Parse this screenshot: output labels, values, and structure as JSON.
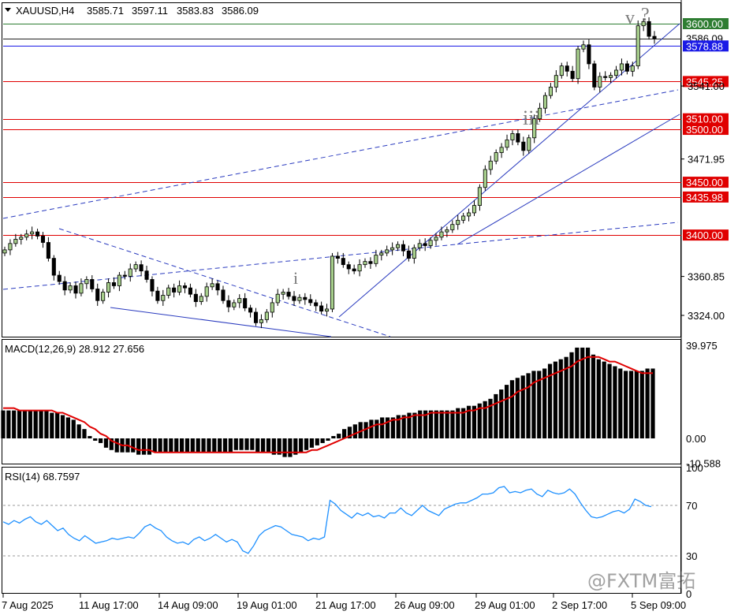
{
  "header": {
    "symbol": "XAUUSD,H4",
    "open": "3585.71",
    "high": "3597.11",
    "low": "3583.83",
    "close": "3586.09"
  },
  "watermark": "@FXTM富拓",
  "wave_labels": {
    "i": "i",
    "iii": "iii",
    "v": "v",
    "q": "?"
  },
  "colors": {
    "candle_up": "#a8d08d",
    "candle_outline": "#000000",
    "level_line": "#e00000",
    "trend_line": "#2a3bbf",
    "bid_line": "#1a1ae6",
    "ask_line": "#2e7d32",
    "macd_signal": "#e00000",
    "rsi_line": "#1e90ff"
  },
  "chart_data": [
    {
      "type": "candlestick",
      "title": "XAUUSD,H4",
      "ylim": [
        3310,
        3630
      ],
      "y_ticks": [
        "3360.85",
        "3324.00",
        "3471.95",
        "3541.00"
      ],
      "x_ticks": [
        "7 Aug 2025",
        "11 Aug 17:00",
        "14 Aug 09:00",
        "19 Aug 01:00",
        "21 Aug 17:00",
        "26 Aug 09:00",
        "29 Aug 01:00",
        "2 Sep 17:00",
        "5 Sep 09:00"
      ],
      "price_labels": [
        {
          "label": "3600.00",
          "value": 3600,
          "kind": "ask"
        },
        {
          "label": "3586.09",
          "value": 3586.09,
          "kind": "current"
        },
        {
          "label": "3578.88",
          "value": 3578.88,
          "kind": "bid"
        },
        {
          "label": "3545.25",
          "value": 3545.25,
          "kind": "level"
        },
        {
          "label": "3510.00",
          "value": 3510,
          "kind": "level"
        },
        {
          "label": "3500.00",
          "value": 3500,
          "kind": "level"
        },
        {
          "label": "3450.00",
          "value": 3450,
          "kind": "level"
        },
        {
          "label": "3435.98",
          "value": 3435.98,
          "kind": "level"
        },
        {
          "label": "3400.00",
          "value": 3400,
          "kind": "level"
        }
      ],
      "close": [
        3386,
        3392,
        3396,
        3398,
        3401,
        3403,
        3399,
        3393,
        3378,
        3362,
        3356,
        3348,
        3352,
        3345,
        3354,
        3358,
        3349,
        3338,
        3346,
        3355,
        3352,
        3362,
        3361,
        3368,
        3372,
        3366,
        3358,
        3347,
        3338,
        3343,
        3350,
        3346,
        3352,
        3350,
        3344,
        3337,
        3342,
        3351,
        3354,
        3348,
        3338,
        3332,
        3336,
        3340,
        3331,
        3327,
        3317,
        3320,
        3327,
        3336,
        3344,
        3346,
        3342,
        3338,
        3341,
        3339,
        3336,
        3333,
        3328,
        3330,
        3380,
        3378,
        3372,
        3368,
        3366,
        3372,
        3375,
        3373,
        3381,
        3383,
        3386,
        3388,
        3391,
        3385,
        3378,
        3388,
        3392,
        3390,
        3395,
        3398,
        3403,
        3405,
        3410,
        3414,
        3418,
        3421,
        3428,
        3445,
        3462,
        3470,
        3478,
        3483,
        3490,
        3496,
        3488,
        3480,
        3492,
        3510,
        3520,
        3532,
        3540,
        3551,
        3560,
        3555,
        3548,
        3576,
        3580,
        3562,
        3540,
        3550,
        3549,
        3551,
        3556,
        3562,
        3555,
        3560,
        3598,
        3602,
        3588,
        3586
      ]
    },
    {
      "type": "bar",
      "title": "MACD(12,26,9)",
      "macd_value": "28.912",
      "signal_value": "27.656",
      "y_ticks": [
        "39.975",
        "0.00",
        "-10.588"
      ],
      "ylim": [
        -10.588,
        39.975
      ],
      "series": [
        {
          "name": "MACD",
          "values": [
            12,
            12,
            12,
            12,
            12,
            12,
            12,
            12,
            12,
            11,
            11,
            10,
            9,
            8,
            6,
            4,
            1,
            -1,
            -2,
            -4,
            -5,
            -6,
            -6,
            -6,
            -6,
            -7,
            -7,
            -7,
            -6,
            -6,
            -6,
            -6,
            -6,
            -6,
            -6,
            -6,
            -6,
            -6,
            -6,
            -6,
            -6,
            -6,
            -6,
            -5,
            -5,
            -5,
            -5,
            -6,
            -6,
            -6,
            -7,
            -7,
            -8,
            -8,
            -7,
            -6,
            -5,
            -4,
            -3,
            -2,
            -1,
            1,
            2,
            4,
            5,
            6,
            7,
            7,
            8,
            8,
            9,
            9,
            9,
            10,
            10,
            11,
            11,
            12,
            12,
            12,
            12,
            12,
            12,
            12,
            13,
            13,
            14,
            14,
            15,
            16,
            17,
            19,
            21,
            23,
            25,
            26,
            27,
            28,
            29,
            29,
            30,
            32,
            33,
            34,
            35,
            37,
            39,
            39,
            39,
            36,
            34,
            33,
            32,
            31,
            30,
            29,
            29,
            29,
            29,
            30,
            30
          ]
        },
        {
          "name": "Signal",
          "values": [
            13,
            13,
            13,
            12,
            12,
            12,
            12,
            12,
            12,
            12,
            11,
            11,
            10,
            9,
            8,
            7,
            5,
            4,
            2,
            1,
            -1,
            -2,
            -3,
            -3,
            -4,
            -5,
            -5,
            -5,
            -6,
            -6,
            -6,
            -6,
            -6,
            -6,
            -6,
            -6,
            -6,
            -6,
            -6,
            -6,
            -6,
            -6,
            -6,
            -6,
            -6,
            -6,
            -6,
            -6,
            -6,
            -6,
            -6,
            -6,
            -6,
            -6,
            -6,
            -6,
            -6,
            -5,
            -5,
            -4,
            -3,
            -2,
            -1,
            0,
            1,
            2,
            3,
            4,
            5,
            6,
            6,
            7,
            8,
            8,
            9,
            9,
            10,
            10,
            10,
            11,
            11,
            11,
            11,
            11,
            11,
            11,
            12,
            12,
            13,
            13,
            14,
            15,
            16,
            17,
            18,
            20,
            21,
            22,
            24,
            25,
            26,
            27,
            28,
            29,
            30,
            31,
            33,
            34,
            35,
            35,
            35,
            34,
            33,
            33,
            32,
            31,
            30,
            29,
            28,
            28,
            28
          ]
        }
      ]
    },
    {
      "type": "line",
      "title": "RSI(14)",
      "rsi_value": "68.7597",
      "ylim": [
        0,
        100
      ],
      "y_ticks": [
        "100",
        "70",
        "30",
        "0"
      ],
      "levels": [
        70,
        30
      ],
      "series": [
        {
          "name": "RSI",
          "values": [
            57,
            55,
            58,
            56,
            59,
            61,
            57,
            55,
            58,
            54,
            50,
            52,
            47,
            44,
            42,
            46,
            43,
            40,
            41,
            42,
            44,
            43,
            44,
            45,
            44,
            48,
            53,
            55,
            52,
            50,
            45,
            42,
            40,
            41,
            39,
            43,
            45,
            42,
            44,
            47,
            44,
            41,
            43,
            41,
            34,
            32,
            38,
            46,
            50,
            52,
            54,
            53,
            50,
            47,
            46,
            45,
            42,
            44,
            43,
            45,
            74,
            71,
            66,
            63,
            60,
            64,
            62,
            64,
            61,
            62,
            60,
            64,
            64,
            68,
            64,
            62,
            66,
            70,
            66,
            64,
            62,
            67,
            69,
            71,
            72,
            72,
            74,
            76,
            79,
            79,
            80,
            84,
            85,
            80,
            81,
            80,
            82,
            83,
            79,
            77,
            82,
            80,
            79,
            80,
            83,
            79,
            72,
            66,
            61,
            60,
            61,
            63,
            65,
            66,
            64,
            67,
            75,
            73,
            70,
            69
          ]
        }
      ]
    }
  ]
}
